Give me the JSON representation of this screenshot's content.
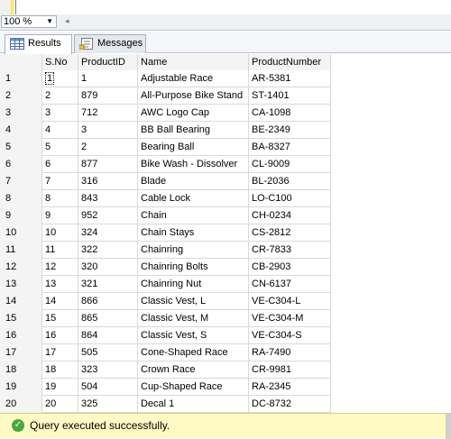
{
  "zoom": {
    "value": "100 %"
  },
  "tabs": [
    {
      "label": "Results",
      "active": true,
      "icon": "grid-icon"
    },
    {
      "label": "Messages",
      "active": false,
      "icon": "messages-icon"
    }
  ],
  "grid": {
    "columns": [
      "",
      "S.No",
      "ProductID",
      "Name",
      "ProductNumber"
    ],
    "rows": [
      [
        "1",
        "1",
        "1",
        "Adjustable Race",
        "AR-5381"
      ],
      [
        "2",
        "2",
        "879",
        "All-Purpose Bike Stand",
        "ST-1401"
      ],
      [
        "3",
        "3",
        "712",
        "AWC Logo Cap",
        "CA-1098"
      ],
      [
        "4",
        "4",
        "3",
        "BB Ball Bearing",
        "BE-2349"
      ],
      [
        "5",
        "5",
        "2",
        "Bearing Ball",
        "BA-8327"
      ],
      [
        "6",
        "6",
        "877",
        "Bike Wash - Dissolver",
        "CL-9009"
      ],
      [
        "7",
        "7",
        "316",
        "Blade",
        "BL-2036"
      ],
      [
        "8",
        "8",
        "843",
        "Cable Lock",
        "LO-C100"
      ],
      [
        "9",
        "9",
        "952",
        "Chain",
        "CH-0234"
      ],
      [
        "10",
        "10",
        "324",
        "Chain Stays",
        "CS-2812"
      ],
      [
        "11",
        "11",
        "322",
        "Chainring",
        "CR-7833"
      ],
      [
        "12",
        "12",
        "320",
        "Chainring Bolts",
        "CB-2903"
      ],
      [
        "13",
        "13",
        "321",
        "Chainring Nut",
        "CN-6137"
      ],
      [
        "14",
        "14",
        "866",
        "Classic Vest, L",
        "VE-C304-L"
      ],
      [
        "15",
        "15",
        "865",
        "Classic Vest, M",
        "VE-C304-M"
      ],
      [
        "16",
        "16",
        "864",
        "Classic Vest, S",
        "VE-C304-S"
      ],
      [
        "17",
        "17",
        "505",
        "Cone-Shaped Race",
        "RA-7490"
      ],
      [
        "18",
        "18",
        "323",
        "Crown Race",
        "CR-9981"
      ],
      [
        "19",
        "19",
        "504",
        "Cup-Shaped Race",
        "RA-2345"
      ],
      [
        "20",
        "20",
        "325",
        "Decal 1",
        "DC-8732"
      ]
    ]
  },
  "status": {
    "message": "Query executed successfully.",
    "icon": "check-icon"
  }
}
